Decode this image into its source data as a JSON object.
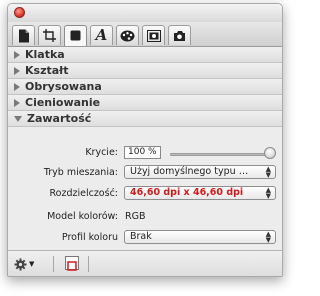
{
  "sections": [
    {
      "label": "Klatka",
      "expanded": false
    },
    {
      "label": "Kształt",
      "expanded": false
    },
    {
      "label": "Obrysowana",
      "expanded": false
    },
    {
      "label": "Cieniowanie",
      "expanded": false
    },
    {
      "label": "Zawartość",
      "expanded": true
    }
  ],
  "tabs": [
    {
      "icon": "document-icon"
    },
    {
      "icon": "frame-crop-icon"
    },
    {
      "icon": "square-icon",
      "active": true
    },
    {
      "icon": "font-icon",
      "glyph": "A"
    },
    {
      "icon": "palette-icon"
    },
    {
      "icon": "image-icon"
    },
    {
      "icon": "camera-icon"
    }
  ],
  "content": {
    "krycie_label": "Krycie:",
    "krycie_value": "100 %",
    "krycie_level": 1.0,
    "tryb_label": "Tryb mieszania:",
    "tryb_value": "Użyj domyślnego typu mi...",
    "rozdz_label": "Rozdzielczość:",
    "rozdz_value": "46,60 dpi x 46,60 dpi",
    "model_label": "Model kolorów:",
    "model_value": "RGB",
    "profil_label": "Profil koloru",
    "profil_value": "Brak"
  },
  "colors": {
    "accent_red": "#d11b1b",
    "close_button": "#d72a1f"
  }
}
